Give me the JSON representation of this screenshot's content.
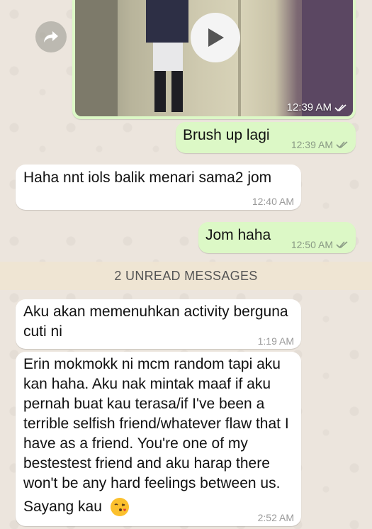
{
  "video_message": {
    "time": "12:39 AM"
  },
  "messages": [
    {
      "text": "Brush up lagi",
      "time": "12:39 AM"
    },
    {
      "text": "Haha nnt iols balik menari sama2 jom",
      "time": "12:40 AM"
    },
    {
      "text": "Jom haha",
      "time": "12:50 AM"
    },
    {
      "text": "Aku akan memenuhkan activity berguna cuti ni",
      "time": "1:19 AM"
    },
    {
      "text": "Erin mokmokk ni mcm random tapi aku kan haha. Aku nak mintak maaf if aku pernah buat kau terasa/if I've been a terrible selfish friend/whatever flaw that I have as a friend. You're one of my bestestest friend and aku harap there won't be any hard feelings between us.",
      "text_end": "Sayang kau",
      "time": "2:52 AM"
    }
  ],
  "unread_banner": "2 UNREAD MESSAGES",
  "colors": {
    "outgoing": "#dcf8c6",
    "incoming": "#ffffff",
    "background": "#ece5dd"
  },
  "icons": [
    "forward-icon",
    "play-icon",
    "double-check-icon",
    "kiss-emoji-icon"
  ]
}
